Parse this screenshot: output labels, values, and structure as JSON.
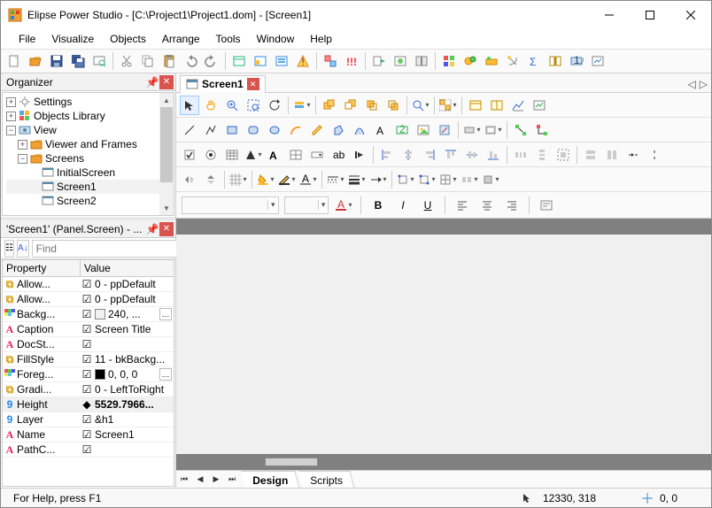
{
  "title": "Elipse Power Studio  - [C:\\Project1\\Project1.dom] - [Screen1]",
  "menu": [
    "File",
    "Visualize",
    "Objects",
    "Arrange",
    "Tools",
    "Window",
    "Help"
  ],
  "panels": {
    "organizer": {
      "title": "Organizer"
    },
    "props": {
      "title": "'Screen1' (Panel.Screen) - ..."
    }
  },
  "tree": [
    {
      "indent": 0,
      "exp": "+",
      "icon": "gear",
      "label": "Settings"
    },
    {
      "indent": 0,
      "exp": "+",
      "icon": "blocks",
      "label": "Objects Library"
    },
    {
      "indent": 0,
      "exp": "-",
      "icon": "eye",
      "label": "View"
    },
    {
      "indent": 1,
      "exp": "+",
      "icon": "folder",
      "label": "Viewer and Frames"
    },
    {
      "indent": 1,
      "exp": "-",
      "icon": "folder",
      "label": "Screens"
    },
    {
      "indent": 2,
      "exp": "",
      "icon": "screen",
      "label": "InitialScreen"
    },
    {
      "indent": 2,
      "exp": "",
      "icon": "screen",
      "label": "Screen1",
      "sel": true
    },
    {
      "indent": 2,
      "exp": "",
      "icon": "screen",
      "label": "Screen2"
    }
  ],
  "search": {
    "placeholder": "Find"
  },
  "propHeaders": {
    "k": "Property",
    "v": "Value"
  },
  "props": [
    {
      "ic": "y",
      "k": "Allow...",
      "v": "0 - ppDefault"
    },
    {
      "ic": "y",
      "k": "Allow...",
      "v": "0 - ppDefault"
    },
    {
      "ic": "c",
      "k": "Backg...",
      "v": "240, ...",
      "color": "#f0f0f0",
      "ell": true
    },
    {
      "ic": "a",
      "k": "Caption",
      "v": "Screen Title"
    },
    {
      "ic": "a",
      "k": "DocSt...",
      "v": ""
    },
    {
      "ic": "y",
      "k": "FillStyle",
      "v": "11 - bkBackg..."
    },
    {
      "ic": "c",
      "k": "Foreg...",
      "v": "0, 0, 0",
      "color": "#000000",
      "ell": true
    },
    {
      "ic": "y",
      "k": "Gradi...",
      "v": "0 - LeftToRight"
    },
    {
      "ic": "9",
      "k": "Height",
      "v": "5529.7966...",
      "sel": true
    },
    {
      "ic": "9",
      "k": "Layer",
      "v": "&h1"
    },
    {
      "ic": "a",
      "k": "Name",
      "v": "Screen1"
    },
    {
      "ic": "a",
      "k": "PathC...",
      "v": ""
    }
  ],
  "docTab": {
    "label": "Screen1"
  },
  "bottomTabs": [
    "Design",
    "Scripts"
  ],
  "status": {
    "help": "For Help, press F1",
    "coords": "12330, 318",
    "origin": "0, 0"
  },
  "formatBar": {
    "bold": "B",
    "italic": "I",
    "under": "U"
  }
}
